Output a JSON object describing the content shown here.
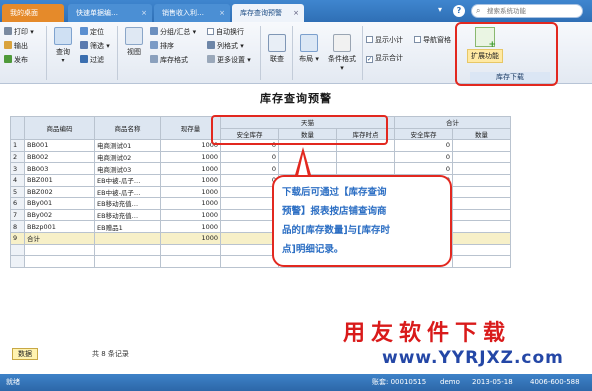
{
  "tabs": [
    {
      "label": "我的桌面"
    },
    {
      "label": "快速单据编…"
    },
    {
      "label": "销售收入利…"
    },
    {
      "label": "库存查询预警"
    }
  ],
  "search": {
    "placeholder": "搜索系统功能"
  },
  "toolbar": {
    "print": "打印",
    "export": "输出",
    "publish": "发布",
    "query": "查询",
    "locate": "定位",
    "filter": "筛选",
    "sift": "过滤",
    "view": "视图",
    "group_summary": "分组/汇总",
    "sort": "排序",
    "stock_format": "库存格式",
    "auto_wrap": "自动换行",
    "column_format": "列格式",
    "more_settings": "更多设置",
    "link": "联查",
    "layout": "布局",
    "cond_format": "条件格式",
    "show_subtotal": "显示小计",
    "nav_window": "导航窗格",
    "show_total": "显示合计",
    "extension": "扩展功能",
    "stock_download": "库存下载"
  },
  "page_title": "库存查询预警",
  "grid": {
    "headers": {
      "code": "商品编码",
      "name": "商品名称",
      "qty": "现存量",
      "tianjin": "天猫",
      "total_group": "合计",
      "safe_stock": "安全库存",
      "quantity": "数量",
      "stock_time": "库存时点",
      "safe_stock2": "安全库存",
      "quantity2": "数量"
    },
    "rows": [
      {
        "idx": "1",
        "code": "BB001",
        "name": "电商测试01",
        "qty": "1000",
        "safe": "0",
        "total_safe": "0"
      },
      {
        "idx": "2",
        "code": "BB002",
        "name": "电商测试02",
        "qty": "1000",
        "safe": "0",
        "total_safe": "0"
      },
      {
        "idx": "3",
        "code": "BB003",
        "name": "电商测试03",
        "qty": "1000",
        "safe": "0",
        "total_safe": "0"
      },
      {
        "idx": "4",
        "code": "BBZ001",
        "name": "EB中被-瓜子…",
        "qty": "1000",
        "safe": "0",
        "total_safe": "0"
      },
      {
        "idx": "5",
        "code": "BBZ002",
        "name": "EB中被-瓜子…",
        "qty": "1000",
        "safe": "0",
        "total_safe": "0"
      },
      {
        "idx": "6",
        "code": "BBy001",
        "name": "EB移动充值…",
        "qty": "1000",
        "safe": "0",
        "total_safe": "0"
      },
      {
        "idx": "7",
        "code": "BBy002",
        "name": "EB移动充值…",
        "qty": "1000",
        "safe": "0",
        "total_safe": "0"
      },
      {
        "idx": "8",
        "code": "BBzp001",
        "name": "EB赠品1",
        "qty": "1000",
        "safe": "0",
        "total_safe": "0"
      }
    ],
    "total_row": {
      "idx": "9",
      "label": "合计",
      "qty": "1000",
      "safe": "0",
      "total_safe": "0"
    }
  },
  "callout": {
    "line1": "下载后可通过【库存查询",
    "line2": "预警】报表按店铺查询商",
    "line3": "品的[库存数量]与[库存时",
    "line4": "点]明细记录。"
  },
  "footer": {
    "page_button": "数据",
    "record_count": "共 8 条记录",
    "watermark_top": "用友软件下载",
    "watermark_url": "www.YYRJXZ.com"
  },
  "statusbar": {
    "left": "就绪",
    "account": "账套: 00010515",
    "user": "demo",
    "date": "2013-05-18",
    "phone": "4006-600-588"
  },
  "colors": {
    "accent_blue": "#2f6fb5",
    "highlight_red": "#e2281f",
    "callout_text": "#2b6ec3",
    "watermark_red": "#d91a1a",
    "watermark_blue": "#2447a6"
  }
}
